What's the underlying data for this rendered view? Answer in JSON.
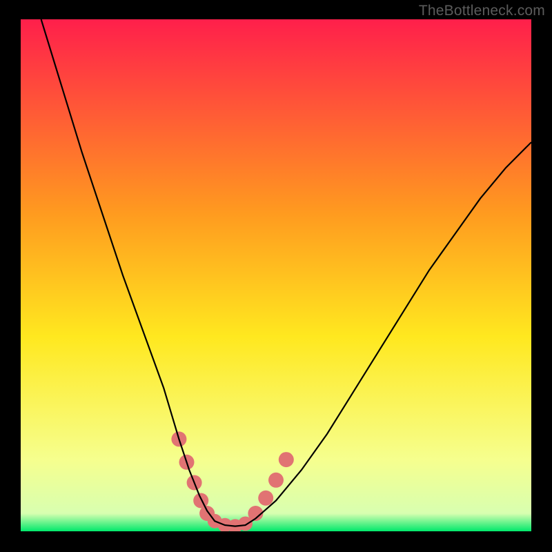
{
  "watermark": "TheBottleneck.com",
  "colors": {
    "bg": "#000000",
    "grad_top": "#ff1f4b",
    "grad_mid1": "#ff9b1f",
    "grad_mid2": "#ffe81f",
    "grad_low": "#f6ff8e",
    "grad_bottom": "#00e86b",
    "curve": "#000000",
    "marker": "#e17373"
  },
  "chart_data": {
    "type": "line",
    "title": "",
    "xlabel": "",
    "ylabel": "",
    "xlim": [
      0,
      100
    ],
    "ylim": [
      0,
      100
    ],
    "note": "No axis ticks or numeric labels are rendered in the source image; values are normalized 0-100 estimates read from pixel positions.",
    "series": [
      {
        "name": "bottleneck-curve",
        "x": [
          4,
          8,
          12,
          16,
          20,
          24,
          28,
          31,
          33,
          35,
          36.5,
          38,
          40,
          42,
          44,
          46,
          50,
          55,
          60,
          65,
          70,
          75,
          80,
          85,
          90,
          95,
          100
        ],
        "y": [
          100,
          87,
          74,
          62,
          50,
          39,
          28,
          18,
          12,
          7,
          4,
          2,
          1.2,
          1,
          1.2,
          2.5,
          6,
          12,
          19,
          27,
          35,
          43,
          51,
          58,
          65,
          71,
          76
        ]
      }
    ],
    "markers": {
      "name": "highlight-band",
      "points": [
        {
          "x": 31.0,
          "y": 18.0
        },
        {
          "x": 32.5,
          "y": 13.5
        },
        {
          "x": 34.0,
          "y": 9.5
        },
        {
          "x": 35.3,
          "y": 6.0
        },
        {
          "x": 36.5,
          "y": 3.5
        },
        {
          "x": 38.0,
          "y": 2.0
        },
        {
          "x": 40.0,
          "y": 1.2
        },
        {
          "x": 42.0,
          "y": 1.0
        },
        {
          "x": 44.0,
          "y": 1.5
        },
        {
          "x": 46.0,
          "y": 3.5
        },
        {
          "x": 48.0,
          "y": 6.5
        },
        {
          "x": 50.0,
          "y": 10.0
        },
        {
          "x": 52.0,
          "y": 14.0
        }
      ]
    }
  }
}
